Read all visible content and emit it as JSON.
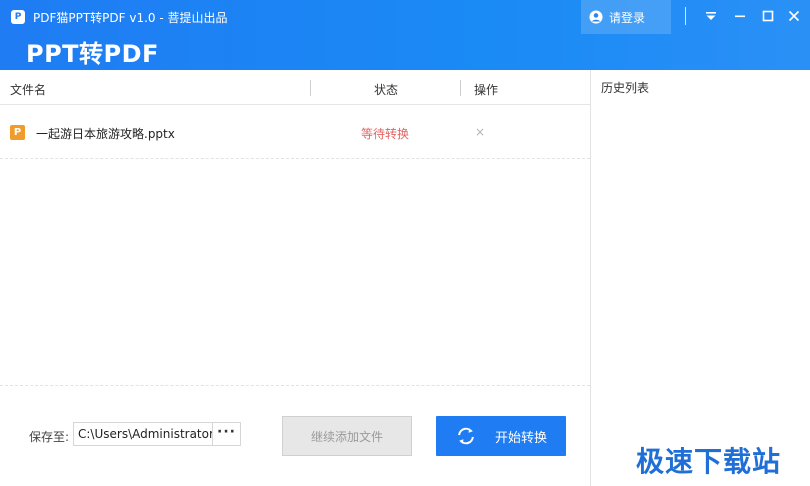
{
  "titlebar": {
    "logo_glyph": "PDF",
    "app_title": "PDF猫PPT转PDF v1.0 - 菩提山出品",
    "big_title": "PPT转PDF",
    "login_label": "请登录",
    "icons": [
      "user-icon",
      "dropdown-menu-icon",
      "minimize-icon",
      "maximize-icon",
      "close-icon"
    ]
  },
  "table": {
    "columns": [
      "文件名",
      "状态",
      "操作"
    ],
    "rows": [
      {
        "icon": "P",
        "file_name": "一起游日本旅游攻略.pptx",
        "status": "等待转换",
        "action": "×"
      }
    ]
  },
  "footer": {
    "save_label": "保存至:",
    "save_path": "C:\\Users\\Administrator",
    "browse_label": "···",
    "add_button": "继续添加文件",
    "start_button": "开始转换"
  },
  "history": {
    "title": "历史列表"
  },
  "watermark": "极速下载站",
  "colors": {
    "accent": "#1f7cf3",
    "status_waiting": "#e06464",
    "file_icon": "#f29b2d"
  }
}
